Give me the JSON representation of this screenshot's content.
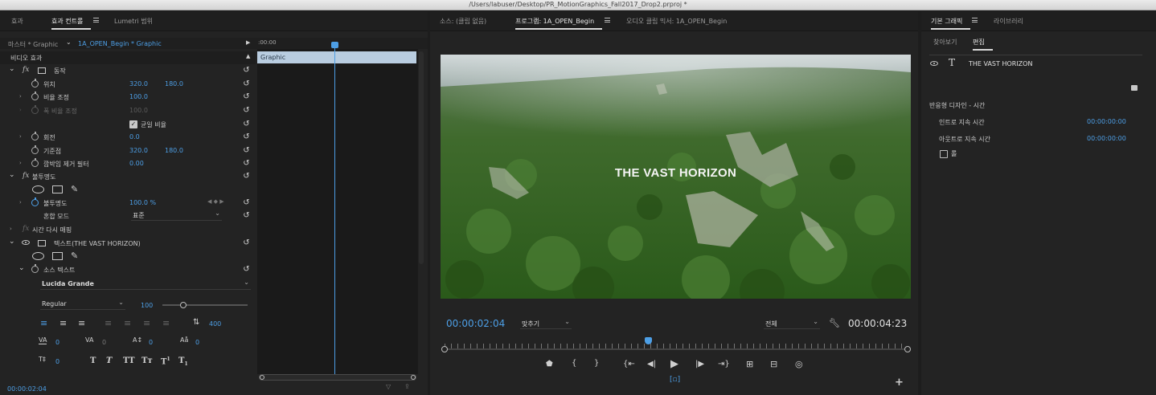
{
  "window": {
    "title": "/Users/labuser/Desktop/PR_MotionGraphics_Fall2017_Drop2.prproj *"
  },
  "left_panel": {
    "tabs": [
      "효과",
      "효과 컨트롤",
      "Lumetri 범위"
    ],
    "active_tab": "효과 컨트롤",
    "master_clip": "마스터 * Graphic",
    "sequence_clip": "1A_OPEN_Begin * Graphic",
    "timeline_start": ":00:00",
    "clip_bar_label": "Graphic",
    "section_video": "비디오 효과",
    "motion": {
      "label": "동작",
      "position_label": "위치",
      "position_x": "320.0",
      "position_y": "180.0",
      "scale_label": "비율 조정",
      "scale_value": "100.0",
      "scale_width_label": "폭 비율 조정",
      "scale_width_value": "100.0",
      "uniform_scale_label": "균일 비율",
      "rotation_label": "회전",
      "rotation_value": "0.0",
      "anchor_label": "기준점",
      "anchor_x": "320.0",
      "anchor_y": "180.0",
      "flicker_label": "깜박임 제거 필터",
      "flicker_value": "0.00"
    },
    "opacity": {
      "label": "불투명도",
      "opacity_label": "불투명도",
      "opacity_value": "100.0 %",
      "blend_label": "혼합 모드",
      "blend_value": "표준"
    },
    "time_remap": {
      "label": "시간 다시 매핑"
    },
    "text_layer": {
      "label": "텍스트(THE VAST HORIZON)",
      "source_text_label": "소스 텍스트",
      "font_family": "Lucida Grande",
      "font_style": "Regular",
      "font_size": "100",
      "leading": "400",
      "kerning": "0",
      "tracking": "0",
      "baseline": "0",
      "tsume": "0",
      "caps": "0"
    },
    "timecode": "00:00:02:04"
  },
  "program_monitor": {
    "tabs": [
      "소스: (클립 없음)",
      "프로그램: 1A_OPEN_Begin",
      "오디오 클립 믹서: 1A_OPEN_Begin"
    ],
    "active_tab": "프로그램: 1A_OPEN_Begin",
    "overlay_title": "THE VAST HORIZON",
    "current_time": "00:00:02:04",
    "fit_label": "맞추기",
    "resolution_label": "전체",
    "duration": "00:00:04:23",
    "playhead_fraction": 0.44
  },
  "essential_graphics": {
    "tabs": [
      "기본 그래픽",
      "라이브러리"
    ],
    "active_tab": "기본 그래픽",
    "subtabs": [
      "찾아보기",
      "편집"
    ],
    "active_subtab": "편집",
    "layer_name": "THE VAST HORIZON",
    "responsive_section": "반응형 디자인 - 시간",
    "intro_label": "인트로 지속 시간",
    "intro_value": "00:00:00:00",
    "outro_label": "아웃트로 지속 시간",
    "outro_value": "00:00:00:00",
    "roll_label": "롤"
  },
  "colors": {
    "accent": "#4d9fe6",
    "panel_bg": "#232323",
    "clip_bar": "#b9cde0"
  }
}
